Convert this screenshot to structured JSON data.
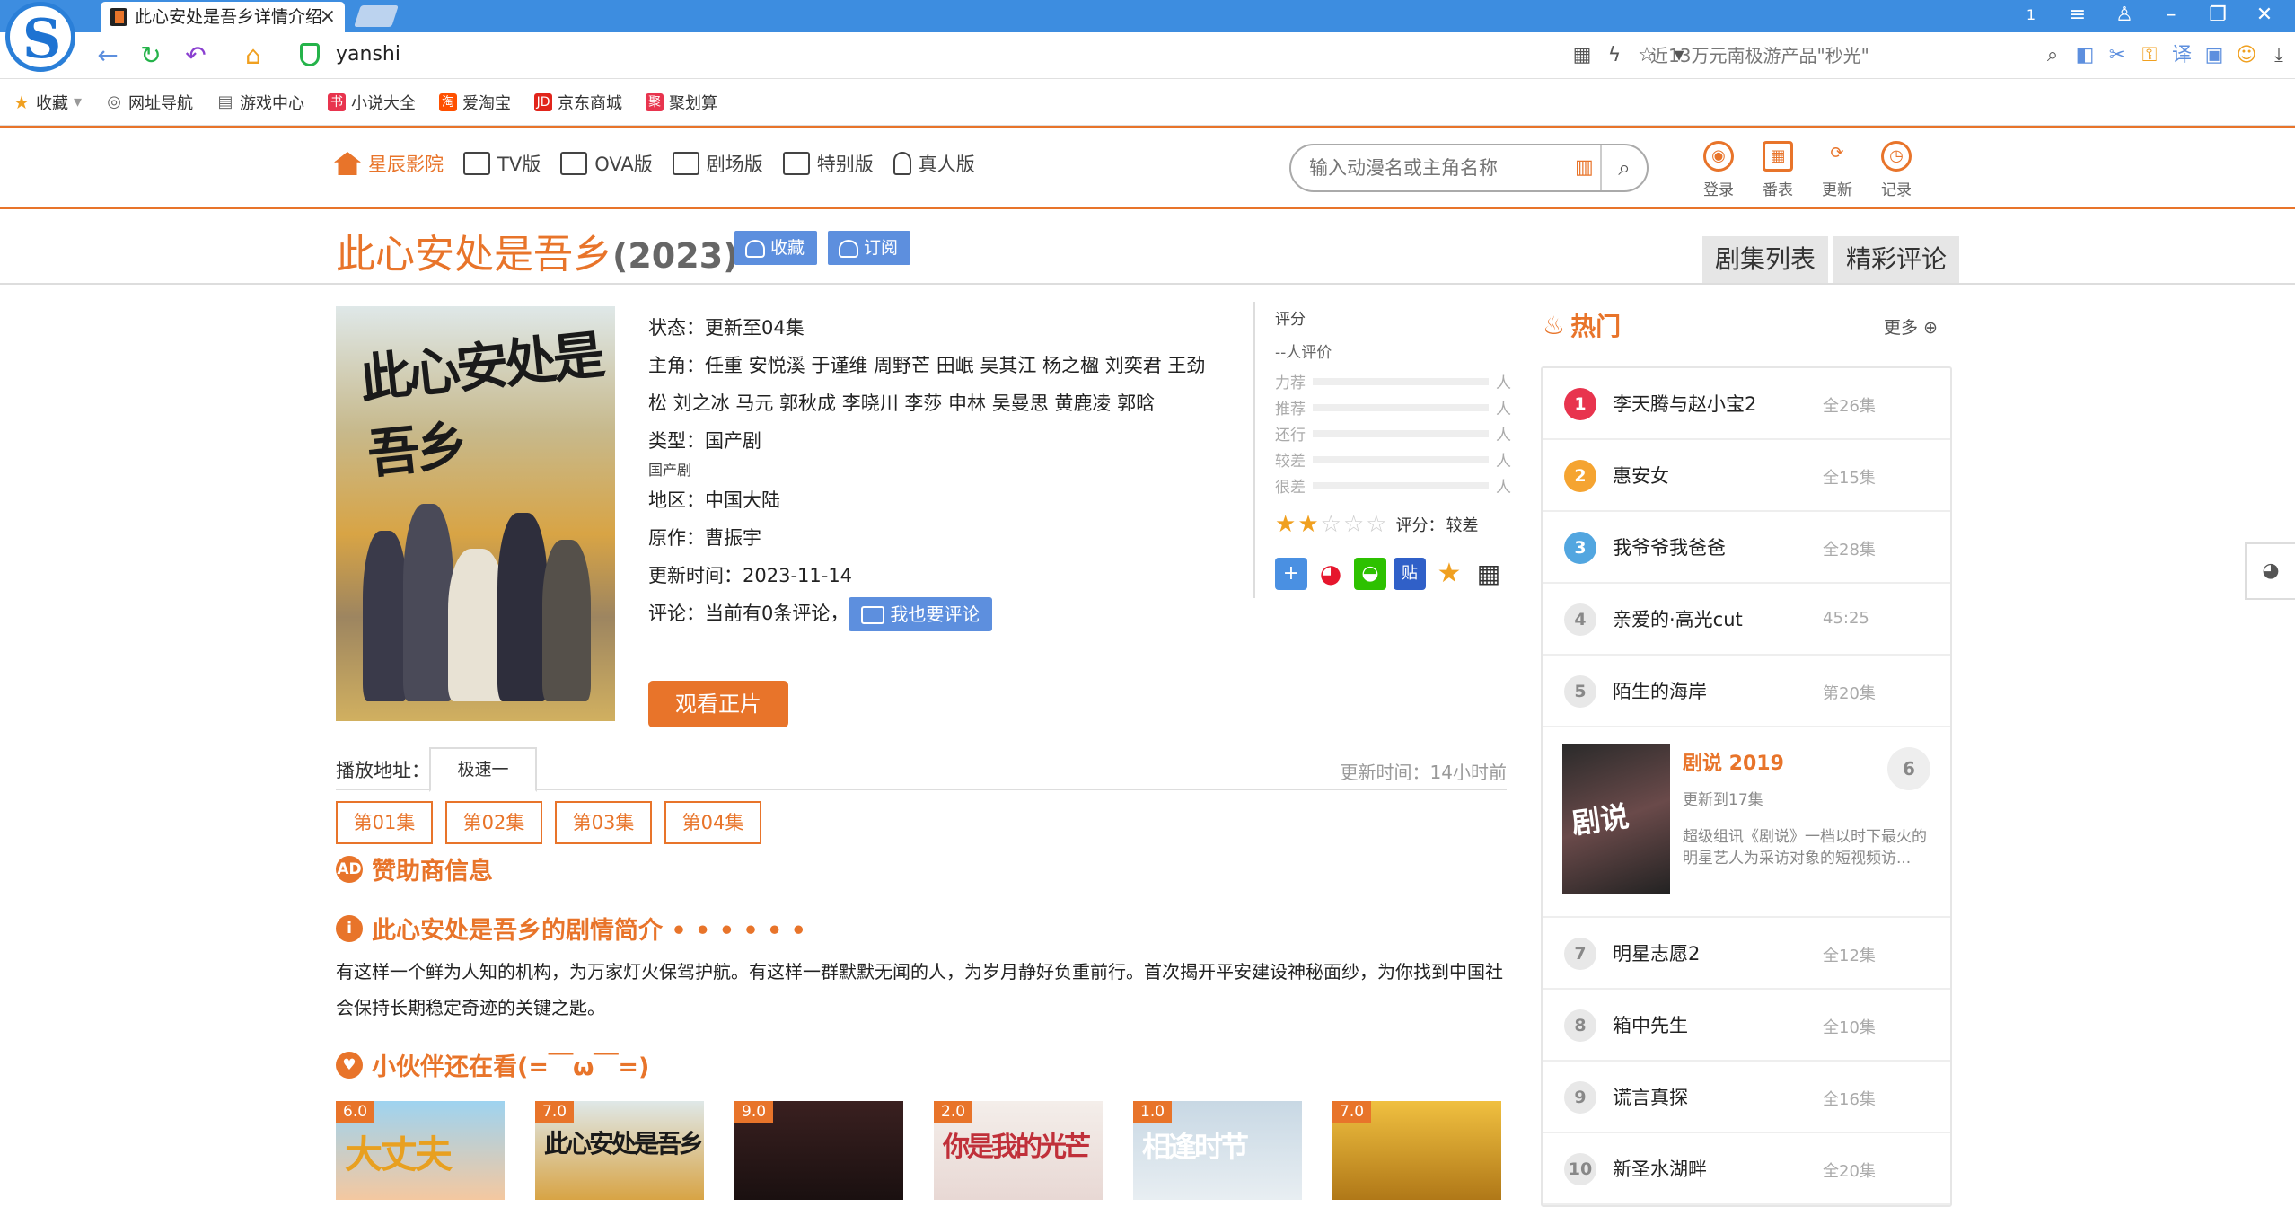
{
  "browser": {
    "tab_title": "此心安处是吾乡详情介绍",
    "close_glyph": "×",
    "url": "yanshi",
    "search_placeholder": "近13万元南极游产品\"秒光\"",
    "window_badge": "1"
  },
  "bookmarks": [
    {
      "label": "收藏",
      "icon": "star-icon",
      "color": "#f0a020"
    },
    {
      "label": "网址导航",
      "icon": "globe-icon",
      "color": "#666"
    },
    {
      "label": "游戏中心",
      "icon": "doc-icon",
      "color": "#666"
    },
    {
      "label": "小说大全",
      "icon": "book-icon",
      "color": "#e8344e"
    },
    {
      "label": "爱淘宝",
      "icon": "taobao-icon",
      "color": "#ff5000"
    },
    {
      "label": "京东商城",
      "icon": "jd-icon",
      "color": "#e1251b"
    },
    {
      "label": "聚划算",
      "icon": "juhuasuan-icon",
      "color": "#e8344e"
    }
  ],
  "nav": {
    "items": [
      "星辰影院",
      "TV版",
      "OVA版",
      "剧场版",
      "特别版",
      "真人版"
    ],
    "search_placeholder": "输入动漫名或主角名称",
    "user": [
      "登录",
      "番表",
      "更新",
      "记录"
    ]
  },
  "detail": {
    "title": "此心安处是吾乡",
    "year": "(2023)",
    "fav_label": "收藏",
    "sub_label": "订阅",
    "right_tabs": [
      "剧集列表",
      "精彩评论"
    ],
    "poster_title": "此心安处是吾乡",
    "status": "状态：更新至04集",
    "cast": "主角：任重   安悦溪   于谨维   周野芒   田岷   吴其江   杨之楹   刘奕君   王劲松   刘之冰   马元   郭秋成   李晓川   李莎   申林   吴曼思   黄鹿凌   郭晗",
    "type": "类型：国产剧",
    "type_small": "国产剧",
    "region": "地区：中国大陆",
    "author": "原作：曹振宇",
    "update_time": "更新时间：2023-11-14",
    "comment": "评论：当前有0条评论，",
    "comment_btn": "我也要评论",
    "watch_btn": "观看正片"
  },
  "rating": {
    "label": "评分",
    "count": "--人评价",
    "rows": [
      "力荐",
      "推荐",
      "还行",
      "较差",
      "很差"
    ],
    "unit": "人",
    "score_text": "评分：",
    "score_value": "较差",
    "stars_on": 2,
    "stars_total": 5
  },
  "play": {
    "label": "播放地址：",
    "source": "极速一",
    "updated": "更新时间：14小时前",
    "episodes": [
      "第01集",
      "第02集",
      "第03集",
      "第04集"
    ]
  },
  "sections": {
    "sponsor": "赞助商信息",
    "intro": "此心安处是吾乡的剧情简介 • • • • • •",
    "friends": "小伙伴还在看(=￣ω￣=)"
  },
  "intro_text": "有这样一个鲜为人知的机构，为万家灯火保驾护航。有这样一群默默无闻的人，为岁月静好负重前行。首次揭开平安建设神秘面纱，为你找到中国社会保持长期稳定奇迹的关键之匙。",
  "thumbs": [
    {
      "score": "6.0",
      "title": "大丈夫"
    },
    {
      "score": "7.0",
      "title": "此心安处是吾乡"
    },
    {
      "score": "9.0",
      "title": ""
    },
    {
      "score": "2.0",
      "title": "你是我的光芒"
    },
    {
      "score": "1.0",
      "title": "相逢时节"
    },
    {
      "score": "7.0",
      "title": ""
    }
  ],
  "hot": {
    "title": "热门",
    "more": "更多",
    "items": [
      {
        "n": "1",
        "t": "李天腾与赵小宝2",
        "e": "全26集"
      },
      {
        "n": "2",
        "t": "惠安女",
        "e": "全15集"
      },
      {
        "n": "3",
        "t": "我爷爷我爸爸",
        "e": "全28集"
      },
      {
        "n": "4",
        "t": "亲爱的·高光cut",
        "e": "45:25"
      },
      {
        "n": "5",
        "t": "陌生的海岸",
        "e": "第20集"
      }
    ],
    "featured": {
      "n": "6",
      "t": "剧说 2019",
      "s": "更新到17集",
      "d": "超级组讯《剧说》一档以时下最火的明星艺人为采访对象的短视频访...",
      "img_text": "剧说"
    },
    "items2": [
      {
        "n": "7",
        "t": "明星志愿2",
        "e": "全12集"
      },
      {
        "n": "8",
        "t": "箱中先生",
        "e": "全10集"
      },
      {
        "n": "9",
        "t": "谎言真探",
        "e": "全16集"
      },
      {
        "n": "10",
        "t": "新圣水湖畔",
        "e": "全20集"
      }
    ]
  }
}
